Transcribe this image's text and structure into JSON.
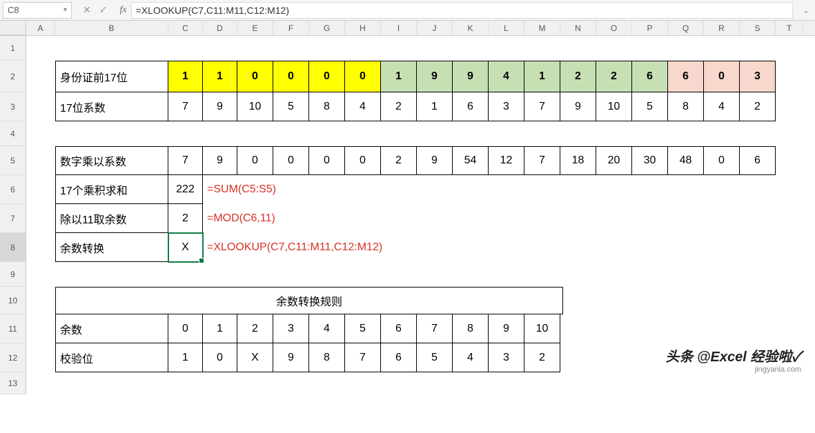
{
  "formula_bar": {
    "cell_ref": "C8",
    "cancel_icon": "✕",
    "confirm_icon": "✓",
    "fx_label": "fx",
    "formula": "=XLOOKUP(C7,C11:M11,C12:M12)",
    "expand_icon": "⌄"
  },
  "columns": [
    "A",
    "B",
    "C",
    "D",
    "E",
    "F",
    "G",
    "H",
    "I",
    "J",
    "K",
    "L",
    "M",
    "N",
    "O",
    "P",
    "Q",
    "R",
    "S",
    "T"
  ],
  "rows": [
    "1",
    "2",
    "3",
    "4",
    "5",
    "6",
    "7",
    "8",
    "9",
    "10",
    "11",
    "12",
    "13"
  ],
  "selected_row": "8",
  "table1": {
    "r2_label": "身份证前17位",
    "r2_vals": [
      "1",
      "1",
      "0",
      "0",
      "0",
      "0",
      "1",
      "9",
      "9",
      "4",
      "1",
      "2",
      "2",
      "6",
      "6",
      "0",
      "3"
    ],
    "r3_label": "17位系数",
    "r3_vals": [
      "7",
      "9",
      "10",
      "5",
      "8",
      "4",
      "2",
      "1",
      "6",
      "3",
      "7",
      "9",
      "10",
      "5",
      "8",
      "4",
      "2"
    ]
  },
  "table2": {
    "r5_label": "数字乘以系数",
    "r5_vals": [
      "7",
      "9",
      "0",
      "0",
      "0",
      "0",
      "2",
      "9",
      "54",
      "12",
      "7",
      "18",
      "20",
      "30",
      "48",
      "0",
      "6"
    ],
    "r6_label": "17个乘积求和",
    "r6_val": "222",
    "r6_formula": "=SUM(C5:S5)",
    "r7_label": "除以11取余数",
    "r7_val": "2",
    "r7_formula": "=MOD(C6,11)",
    "r8_label": "余数转换",
    "r8_val": "X",
    "r8_formula": "=XLOOKUP(C7,C11:M11,C12:M12)"
  },
  "table3": {
    "r10_label": "余数转换规则",
    "r11_label": "余数",
    "r11_vals": [
      "0",
      "1",
      "2",
      "3",
      "4",
      "5",
      "6",
      "7",
      "8",
      "9",
      "10"
    ],
    "r12_label": "校验位",
    "r12_vals": [
      "1",
      "0",
      "X",
      "9",
      "8",
      "7",
      "6",
      "5",
      "4",
      "3",
      "2"
    ]
  },
  "watermark": {
    "main": "头条 @Excel 经验啦✓",
    "sub": "jingyanla.com"
  },
  "chart_data": {
    "type": "table",
    "title": "ID checksum calculation (身份证校验位)",
    "inputs": {
      "digits_first_17": [
        1,
        1,
        0,
        0,
        0,
        0,
        1,
        9,
        9,
        4,
        1,
        2,
        2,
        6,
        6,
        0,
        3
      ],
      "weights_17": [
        7,
        9,
        10,
        5,
        8,
        4,
        2,
        1,
        6,
        3,
        7,
        9,
        10,
        5,
        8,
        4,
        2
      ]
    },
    "derived": {
      "products": [
        7,
        9,
        0,
        0,
        0,
        0,
        2,
        9,
        54,
        12,
        7,
        18,
        20,
        30,
        48,
        0,
        6
      ],
      "sum_products": 222,
      "mod_11": 2,
      "checksum_char": "X"
    },
    "lookup_rule": {
      "remainder": [
        0,
        1,
        2,
        3,
        4,
        5,
        6,
        7,
        8,
        9,
        10
      ],
      "check_digit": [
        "1",
        "0",
        "X",
        "9",
        "8",
        "7",
        "6",
        "5",
        "4",
        "3",
        "2"
      ]
    }
  }
}
